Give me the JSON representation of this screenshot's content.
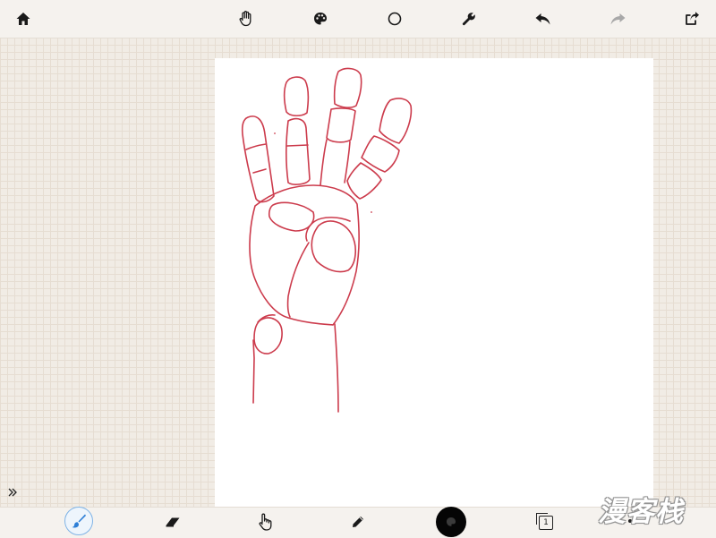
{
  "toolbar_top": {
    "items": [
      {
        "name": "home",
        "icon": "home-icon"
      },
      {
        "name": "pan",
        "icon": "hand-icon"
      },
      {
        "name": "palette",
        "icon": "palette-icon"
      },
      {
        "name": "shape",
        "icon": "circle-icon"
      },
      {
        "name": "settings",
        "icon": "wrench-icon"
      },
      {
        "name": "undo",
        "icon": "undo-icon"
      },
      {
        "name": "redo",
        "icon": "redo-icon"
      },
      {
        "name": "share",
        "icon": "share-icon"
      }
    ]
  },
  "toolbar_bottom": {
    "items": [
      {
        "name": "brush",
        "icon": "brush-icon",
        "selected": true
      },
      {
        "name": "eraser",
        "icon": "eraser-icon"
      },
      {
        "name": "smudge",
        "icon": "finger-icon"
      },
      {
        "name": "pencil",
        "icon": "pencil-icon"
      },
      {
        "name": "color",
        "icon": "color-swatch-icon"
      },
      {
        "name": "layers",
        "icon": "layers-icon"
      },
      {
        "name": "more",
        "icon": "more-icon"
      }
    ],
    "layer_count": "1",
    "current_color": "#000000"
  },
  "drawing": {
    "stroke_color": "#cc3b4c",
    "subject": "hand-sketch"
  },
  "watermark": {
    "text": "漫客栈"
  },
  "colors": {
    "accent": "#7fb3e6",
    "background": "#f1ece5",
    "redo_disabled": "#a8a8a8"
  }
}
